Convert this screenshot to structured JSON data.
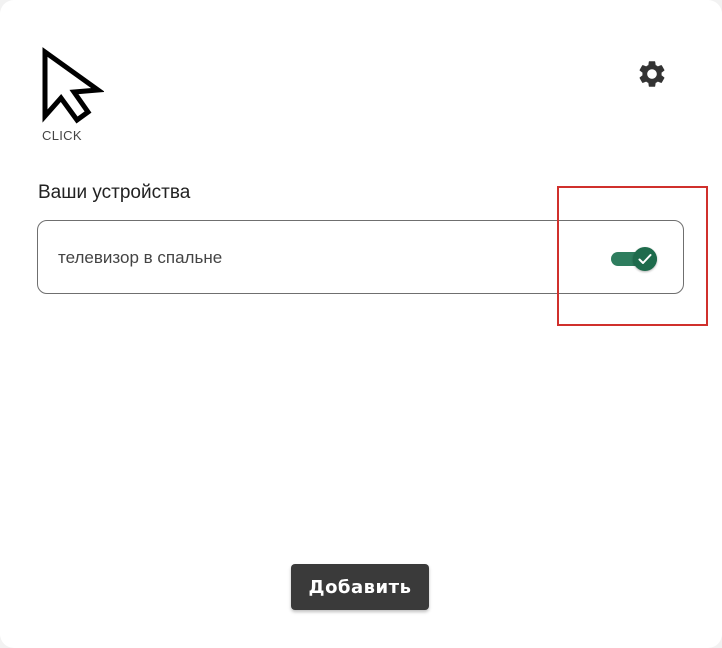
{
  "app": {
    "logo_text": "CLICK",
    "logo_icon": "cursor-arrow-icon",
    "settings_icon": "gear-icon"
  },
  "devices_section": {
    "title": "Ваши устройства",
    "devices": [
      {
        "name": "телевизор в спальне",
        "enabled": true
      }
    ]
  },
  "actions": {
    "add_label": "Добавить"
  },
  "colors": {
    "toggle_on": "#2e7d5e",
    "highlight": "#d0302c",
    "button_bg": "#3a3a3a"
  }
}
